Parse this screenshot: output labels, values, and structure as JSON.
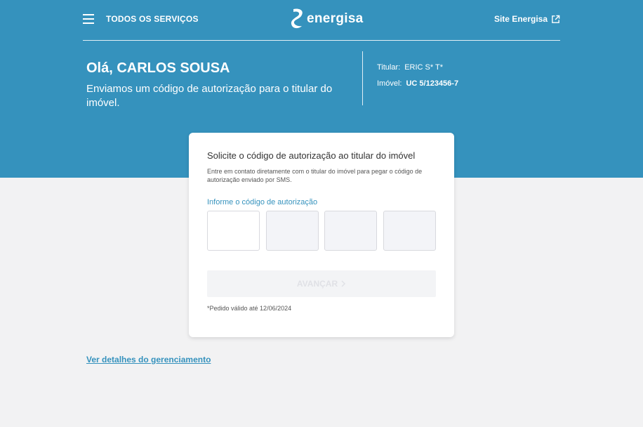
{
  "header": {
    "menu_label": "TODOS OS SERVIÇOS",
    "logo_text": "energisa",
    "site_link": "Site Energisa"
  },
  "hero": {
    "greeting": "Olá, CARLOS SOUSA",
    "subtitle": "Enviamos um código de autorização para o titular do imóvel.",
    "titular_label": "Titular:",
    "titular_value": "ERIC S* T*",
    "imovel_label": "Imóvel:",
    "imovel_value": "UC 5/123456-7"
  },
  "card": {
    "title": "Solicite o código de autorização ao titular do imóvel",
    "description": "Entre em contato diretamente com o titular do imóvel para pegar o código de autorização enviado por SMS.",
    "code_label": "Informe o código de autorização",
    "advance_label": "AVANÇAR",
    "validity": "*Pedido válido até 12/06/2024"
  },
  "details_link": "Ver detalhes do gerenciamento",
  "colors": {
    "brand": "#3592bd",
    "background": "#f2f2f3",
    "disabled_text": "#e0e1e6"
  },
  "icons": {
    "menu": "hamburger-icon",
    "external": "external-link-icon",
    "chevron": "chevron-right-icon"
  }
}
